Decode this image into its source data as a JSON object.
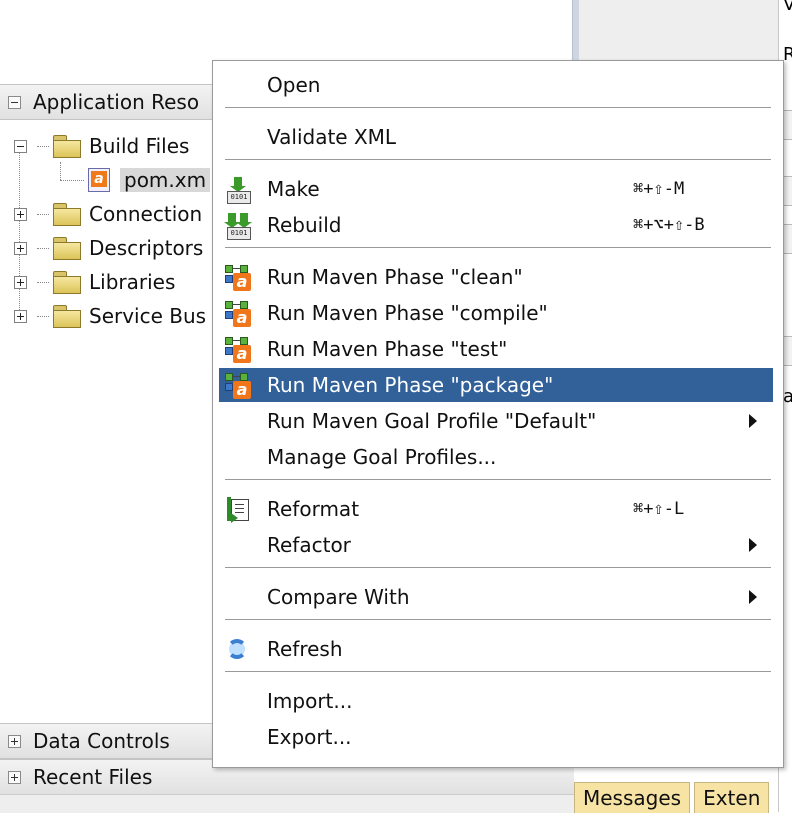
{
  "panels": {
    "application_resources": "Application Reso",
    "data_controls": "Data Controls",
    "recent_files": "Recent Files"
  },
  "tree": {
    "build_files": "Build Files",
    "pom": "pom.xm",
    "connections": "Connection",
    "descriptors": "Descriptors",
    "libraries": "Libraries",
    "service_bus": "Service Bus"
  },
  "right_edge": {
    "letter1": "V",
    "letter2": "R",
    "letter3": "a"
  },
  "bottom_tabs": {
    "messages": "Messages",
    "extensions": "Exten"
  },
  "menu": {
    "open": "Open",
    "validate_xml": "Validate XML",
    "make": "Make",
    "make_shortcut": "⌘+⇧-M",
    "rebuild": "Rebuild",
    "rebuild_shortcut": "⌘+⌥+⇧-B",
    "run_clean": "Run Maven Phase \"clean\"",
    "run_compile": "Run Maven Phase \"compile\"",
    "run_test": "Run Maven Phase \"test\"",
    "run_package": "Run Maven Phase \"package\"",
    "run_goal_profile": "Run Maven Goal Profile \"Default\"",
    "manage_goal_profiles": "Manage Goal Profiles...",
    "reformat": "Reformat",
    "reformat_shortcut": "⌘+⇧-L",
    "refactor": "Refactor",
    "compare_with": "Compare With",
    "refresh": "Refresh",
    "import": "Import...",
    "export": "Export..."
  },
  "colors": {
    "selection": "#32619a",
    "tab_yellow": "#f7e3a4"
  }
}
